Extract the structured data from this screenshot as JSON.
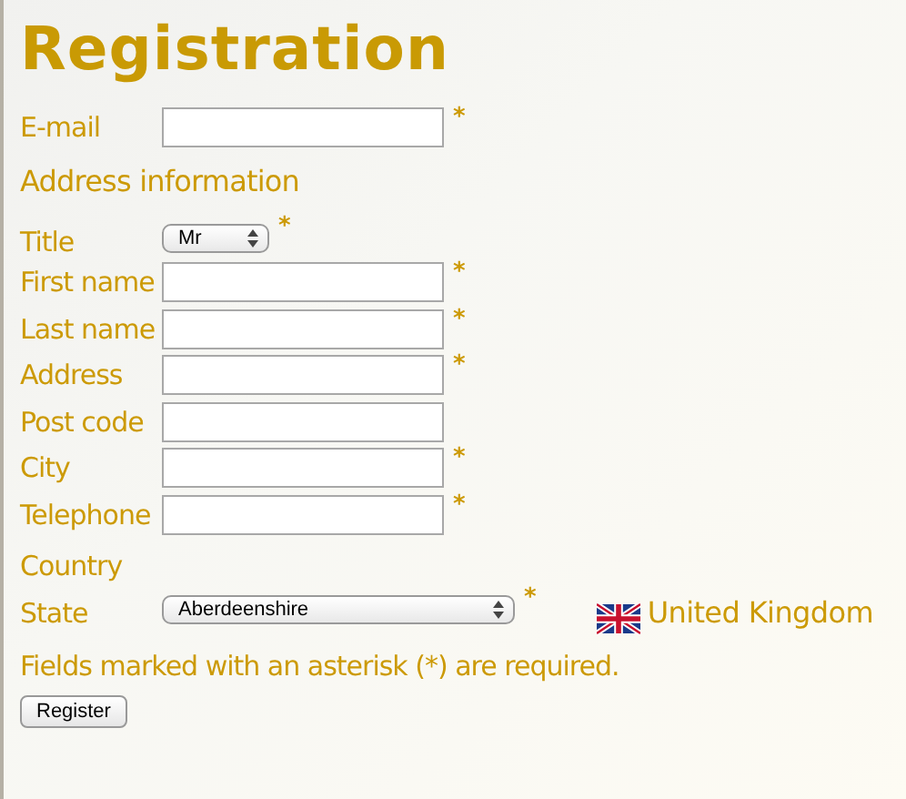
{
  "title": "Registration",
  "account_fields": [
    {
      "kind": "text",
      "label": "E-mail",
      "required": true
    }
  ],
  "address_section": {
    "heading": "Address information",
    "fields": [
      {
        "kind": "select",
        "label": "Title",
        "value": "Mr",
        "required": true
      },
      {
        "kind": "text",
        "label": "First name",
        "required": true
      },
      {
        "kind": "text",
        "label": "Last name",
        "required": true
      },
      {
        "kind": "text",
        "label": "Address",
        "required": true
      },
      {
        "kind": "text",
        "label": "Post code",
        "required": false
      },
      {
        "kind": "text",
        "label": "City",
        "required": true
      },
      {
        "kind": "text",
        "label": "Telephone",
        "required": true
      },
      {
        "kind": "none",
        "label": "Country",
        "required": false
      },
      {
        "kind": "select",
        "label": "State",
        "value": "Aberdeenshire",
        "required": true,
        "country": "United Kingdom"
      }
    ]
  },
  "required_mark": "*",
  "note": "Fields marked with an asterisk (*) are required.",
  "submit": "Register"
}
